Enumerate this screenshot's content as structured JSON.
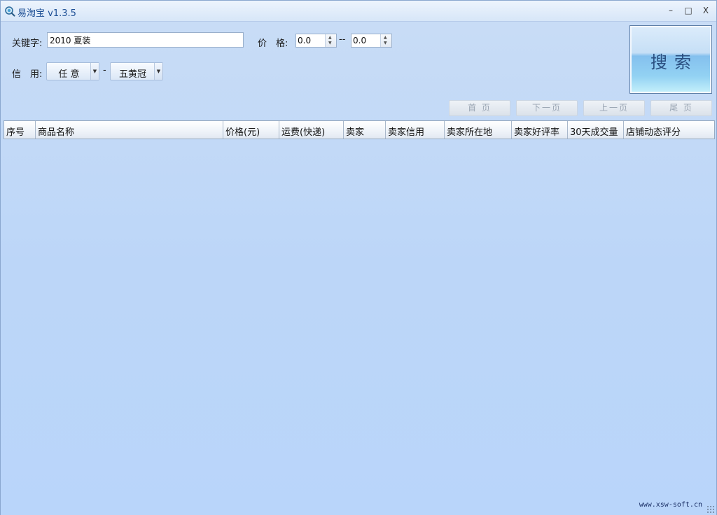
{
  "window": {
    "title": "易淘宝 v1.3.5",
    "minimize_label": "–",
    "maximize_label": "□",
    "close_label": "X"
  },
  "filters": {
    "keyword_label": "关键字:",
    "keyword_value": "2010 夏装",
    "price_label": "价　格:",
    "price_min": "0.0",
    "price_sep": "--",
    "price_max": "0.0",
    "credit_label": "信　用:",
    "credit_from": "任 意",
    "credit_sep": "-",
    "credit_to": "五黄冠"
  },
  "search_button": "搜索",
  "pager": {
    "first": "首 页",
    "next": "下一页",
    "prev": "上一页",
    "last": "尾 页"
  },
  "table": {
    "columns": [
      "序号",
      "商品名称",
      "价格(元)",
      "运费(快递)",
      "卖家",
      "卖家信用",
      "卖家所在地",
      "卖家好评率",
      "30天成交量",
      "店铺动态评分"
    ]
  },
  "footer": {
    "site": "www.xsw-soft.cn"
  },
  "colors": {
    "accent": "#1d4f95",
    "client_bg": "#bcd6f8"
  }
}
